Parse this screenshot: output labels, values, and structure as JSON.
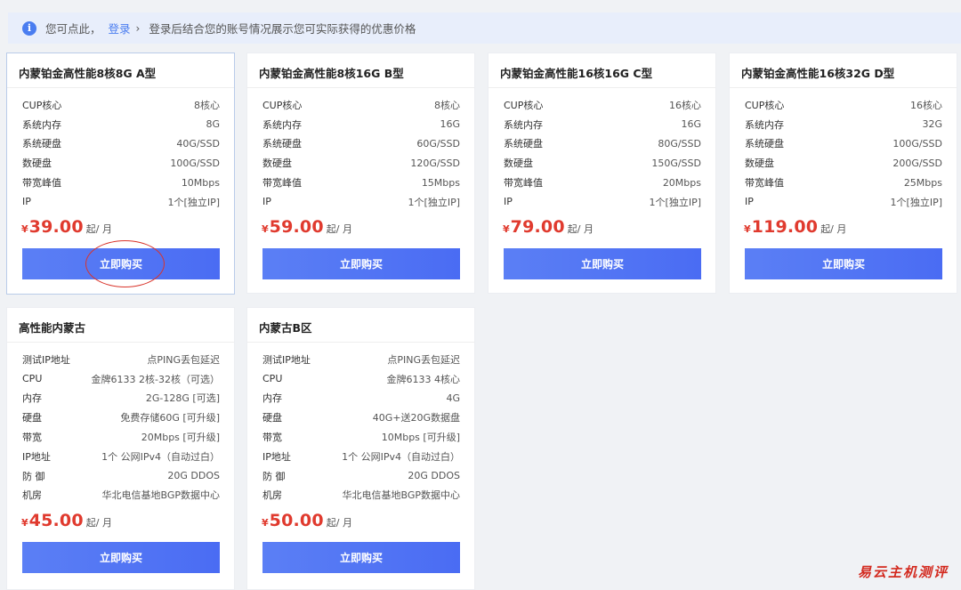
{
  "notice": {
    "icon": "info-icon",
    "prefix": "您可点此，",
    "login_label": "登录",
    "chevron": "›",
    "message": "登录后结合您的账号情况展示您可实际获得的优惠价格"
  },
  "cards": [
    {
      "title": "内蒙铂金高性能8核8G A型",
      "specs": [
        {
          "label": "CUP核心",
          "value": "8核心"
        },
        {
          "label": "系统内存",
          "value": "8G"
        },
        {
          "label": "系统硬盘",
          "value": "40G/SSD"
        },
        {
          "label": "数硬盘",
          "value": "100G/SSD"
        },
        {
          "label": "带宽峰值",
          "value": "10Mbps"
        },
        {
          "label": "IP",
          "value": "1个[独立IP]"
        }
      ],
      "currency": "¥",
      "price": "39.00",
      "unit": "起/ 月",
      "button": "立即购买"
    },
    {
      "title": "内蒙铂金高性能8核16G B型",
      "specs": [
        {
          "label": "CUP核心",
          "value": "8核心"
        },
        {
          "label": "系统内存",
          "value": "16G"
        },
        {
          "label": "系统硬盘",
          "value": "60G/SSD"
        },
        {
          "label": "数硬盘",
          "value": "120G/SSD"
        },
        {
          "label": "带宽峰值",
          "value": "15Mbps"
        },
        {
          "label": "IP",
          "value": "1个[独立IP]"
        }
      ],
      "currency": "¥",
      "price": "59.00",
      "unit": "起/ 月",
      "button": "立即购买"
    },
    {
      "title": "内蒙铂金高性能16核16G C型",
      "specs": [
        {
          "label": "CUP核心",
          "value": "16核心"
        },
        {
          "label": "系统内存",
          "value": "16G"
        },
        {
          "label": "系统硬盘",
          "value": "80G/SSD"
        },
        {
          "label": "数硬盘",
          "value": "150G/SSD"
        },
        {
          "label": "带宽峰值",
          "value": "20Mbps"
        },
        {
          "label": "IP",
          "value": "1个[独立IP]"
        }
      ],
      "currency": "¥",
      "price": "79.00",
      "unit": "起/ 月",
      "button": "立即购买"
    },
    {
      "title": "内蒙铂金高性能16核32G D型",
      "specs": [
        {
          "label": "CUP核心",
          "value": "16核心"
        },
        {
          "label": "系统内存",
          "value": "32G"
        },
        {
          "label": "系统硬盘",
          "value": "100G/SSD"
        },
        {
          "label": "数硬盘",
          "value": "200G/SSD"
        },
        {
          "label": "带宽峰值",
          "value": "25Mbps"
        },
        {
          "label": "IP",
          "value": "1个[独立IP]"
        }
      ],
      "currency": "¥",
      "price": "119.00",
      "unit": "起/ 月",
      "button": "立即购买"
    },
    {
      "title": "高性能内蒙古",
      "specs": [
        {
          "label": "测试IP地址",
          "value": "点PING丢包延迟"
        },
        {
          "label": "CPU",
          "value": "金牌6133 2核-32核（可选）"
        },
        {
          "label": "内存",
          "value": "2G-128G [可选]"
        },
        {
          "label": "硬盘",
          "value": "免费存储60G [可升级]"
        },
        {
          "label": "带宽",
          "value": "20Mbps [可升级]"
        },
        {
          "label": "IP地址",
          "value": "1个 公网IPv4（自动过白）"
        },
        {
          "label": "防 御",
          "value": "20G DDOS"
        },
        {
          "label": "机房",
          "value": "华北电信基地BGP数据中心"
        }
      ],
      "currency": "¥",
      "price": "45.00",
      "unit": "起/ 月",
      "button": "立即购买"
    },
    {
      "title": "内蒙古B区",
      "specs": [
        {
          "label": "测试IP地址",
          "value": "点PING丢包延迟"
        },
        {
          "label": "CPU",
          "value": "金牌6133 4核心"
        },
        {
          "label": "内存",
          "value": "4G"
        },
        {
          "label": "硬盘",
          "value": "40G+送20G数据盘"
        },
        {
          "label": "带宽",
          "value": "10Mbps [可升级]"
        },
        {
          "label": "IP地址",
          "value": "1个 公网IPv4（自动过白）"
        },
        {
          "label": "防 御",
          "value": "20G DDOS"
        },
        {
          "label": "机房",
          "value": "华北电信基地BGP数据中心"
        }
      ],
      "currency": "¥",
      "price": "50.00",
      "unit": "起/ 月",
      "button": "立即购买"
    }
  ],
  "watermark": "易云主机测评",
  "colors": {
    "accent": "#4a6cf3",
    "price": "#e03a2e",
    "notice_bg": "#e8eefb"
  }
}
